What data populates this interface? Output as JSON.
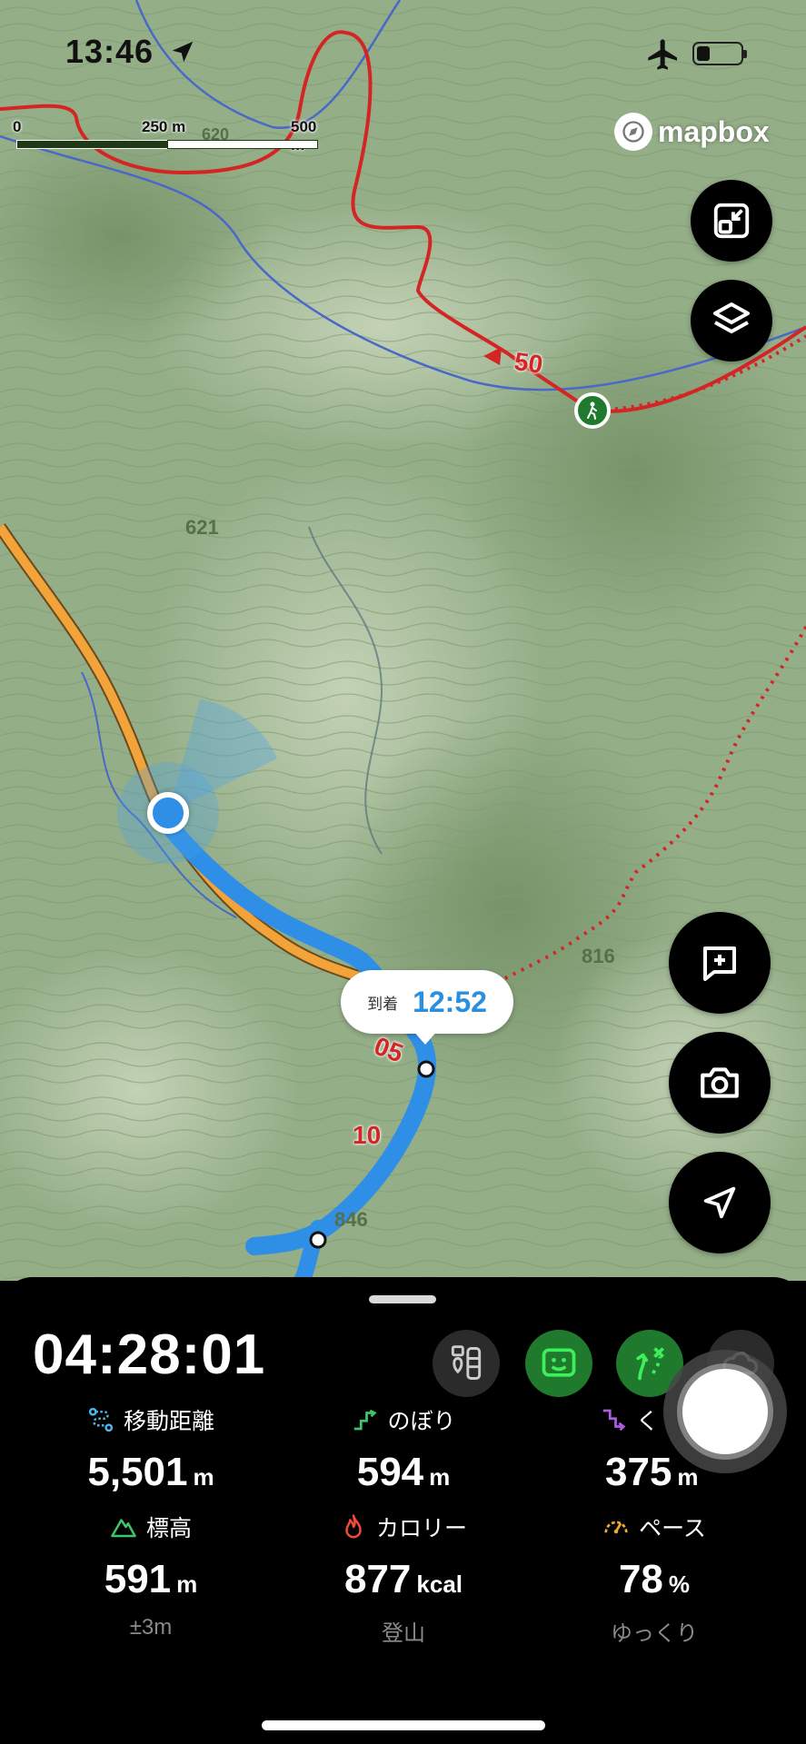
{
  "status_bar": {
    "time": "13:46",
    "icons": [
      "location-arrow-icon",
      "airplane-icon",
      "battery-icon"
    ]
  },
  "scale": {
    "labels": [
      "0",
      "250 m",
      "500 m"
    ]
  },
  "brand": {
    "logo_text": "mapbox"
  },
  "map_labels": {
    "contour_620": "620",
    "peak_621": "621",
    "peak_816": "816",
    "peak_846": "846",
    "route_marker_50": "50",
    "route_marker_05": "05",
    "route_marker_10": "10"
  },
  "map_buttons": [
    "expand-button",
    "layers-button",
    "add-note-button",
    "camera-button",
    "recenter-button"
  ],
  "eta": {
    "label": "到着",
    "time": "12:52"
  },
  "panel": {
    "elapsed_time": "04:28:01",
    "stats": [
      {
        "title": "移動距離",
        "value": "5,501",
        "unit": "m",
        "sub": "",
        "icon": "route-distance-icon",
        "color": "#4fb4e8"
      },
      {
        "title": "のぼり",
        "value": "594",
        "unit": "m",
        "sub": "",
        "icon": "ascent-icon",
        "color": "#3ec46a"
      },
      {
        "title": "く",
        "value": "375",
        "unit": "m",
        "sub": "",
        "icon": "descent-icon",
        "color": "#b05ae0"
      },
      {
        "title": "標高",
        "value": "591",
        "unit": "m",
        "sub": "±3m",
        "icon": "elevation-icon",
        "color": "#3ec46a"
      },
      {
        "title": "カロリー",
        "value": "877",
        "unit": "kcal",
        "sub": "登山",
        "icon": "calorie-icon",
        "color": "#f04a3a"
      },
      {
        "title": "ペース",
        "value": "78",
        "unit": "%",
        "sub": "ゆっくり",
        "icon": "pace-icon",
        "color": "#f0a830"
      }
    ]
  },
  "colors": {
    "route_blue": "#2f8fe6",
    "trail_red": "#e02828",
    "road_orange": "#f2a43a",
    "accent_green": "#1f7a2e"
  }
}
